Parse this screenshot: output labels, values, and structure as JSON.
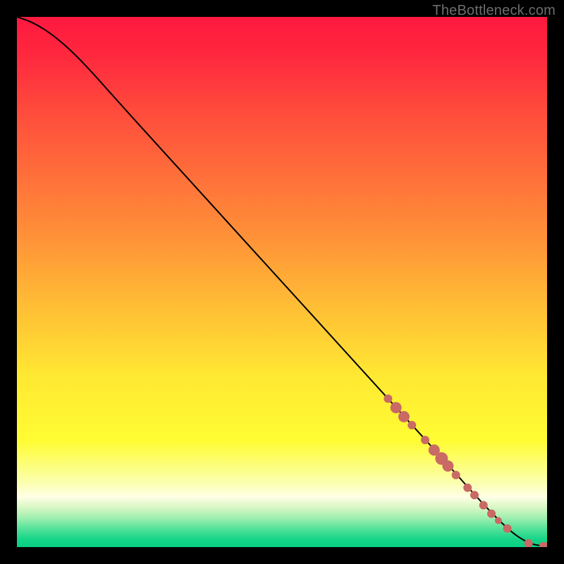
{
  "watermark": "TheBottleneck.com",
  "chart_data": {
    "type": "line",
    "title": "",
    "xlabel": "",
    "ylabel": "",
    "xlim": [
      0,
      100
    ],
    "ylim": [
      0,
      100
    ],
    "grid": false,
    "legend": false,
    "curve": {
      "x": [
        0,
        3,
        7,
        12,
        20,
        30,
        40,
        50,
        60,
        70,
        80,
        88,
        93,
        96,
        98,
        100
      ],
      "y": [
        100,
        99,
        96.5,
        92,
        83,
        72,
        61,
        50,
        39,
        28,
        17,
        8,
        3,
        1,
        0.3,
        0.3
      ]
    },
    "point_cluster": {
      "name": "highlight",
      "color": "#c96a64",
      "points": [
        {
          "x": 70,
          "y": 28,
          "r": 6
        },
        {
          "x": 71.5,
          "y": 26.3,
          "r": 8
        },
        {
          "x": 73,
          "y": 24.6,
          "r": 8
        },
        {
          "x": 74.5,
          "y": 23,
          "r": 6
        },
        {
          "x": 77,
          "y": 20.2,
          "r": 6
        },
        {
          "x": 78.7,
          "y": 18.3,
          "r": 8
        },
        {
          "x": 80.1,
          "y": 16.7,
          "r": 9
        },
        {
          "x": 81.3,
          "y": 15.3,
          "r": 8
        },
        {
          "x": 82.8,
          "y": 13.6,
          "r": 6
        },
        {
          "x": 85,
          "y": 11.2,
          "r": 6
        },
        {
          "x": 86.3,
          "y": 9.8,
          "r": 6
        },
        {
          "x": 88,
          "y": 7.9,
          "r": 6
        },
        {
          "x": 89.5,
          "y": 6.3,
          "r": 6
        },
        {
          "x": 90.8,
          "y": 5.0,
          "r": 5
        },
        {
          "x": 92.5,
          "y": 3.5,
          "r": 6
        },
        {
          "x": 96.5,
          "y": 0.7,
          "r": 6
        },
        {
          "x": 99.2,
          "y": 0.3,
          "r": 5
        },
        {
          "x": 100,
          "y": 0.3,
          "r": 5
        }
      ]
    },
    "background_gradient": {
      "stops": [
        {
          "offset": 0.0,
          "color": "#ff183f"
        },
        {
          "offset": 0.08,
          "color": "#ff2a3e"
        },
        {
          "offset": 0.18,
          "color": "#ff4c3c"
        },
        {
          "offset": 0.3,
          "color": "#ff6f3a"
        },
        {
          "offset": 0.42,
          "color": "#ff9338"
        },
        {
          "offset": 0.55,
          "color": "#ffbf35"
        },
        {
          "offset": 0.68,
          "color": "#ffe932"
        },
        {
          "offset": 0.8,
          "color": "#fffc33"
        },
        {
          "offset": 0.88,
          "color": "#fbffb1"
        },
        {
          "offset": 0.905,
          "color": "#ffffe6"
        },
        {
          "offset": 0.925,
          "color": "#d8f7c4"
        },
        {
          "offset": 0.945,
          "color": "#9fefb0"
        },
        {
          "offset": 0.965,
          "color": "#55e29a"
        },
        {
          "offset": 0.985,
          "color": "#16d588"
        },
        {
          "offset": 1.0,
          "color": "#07cf83"
        }
      ]
    }
  }
}
